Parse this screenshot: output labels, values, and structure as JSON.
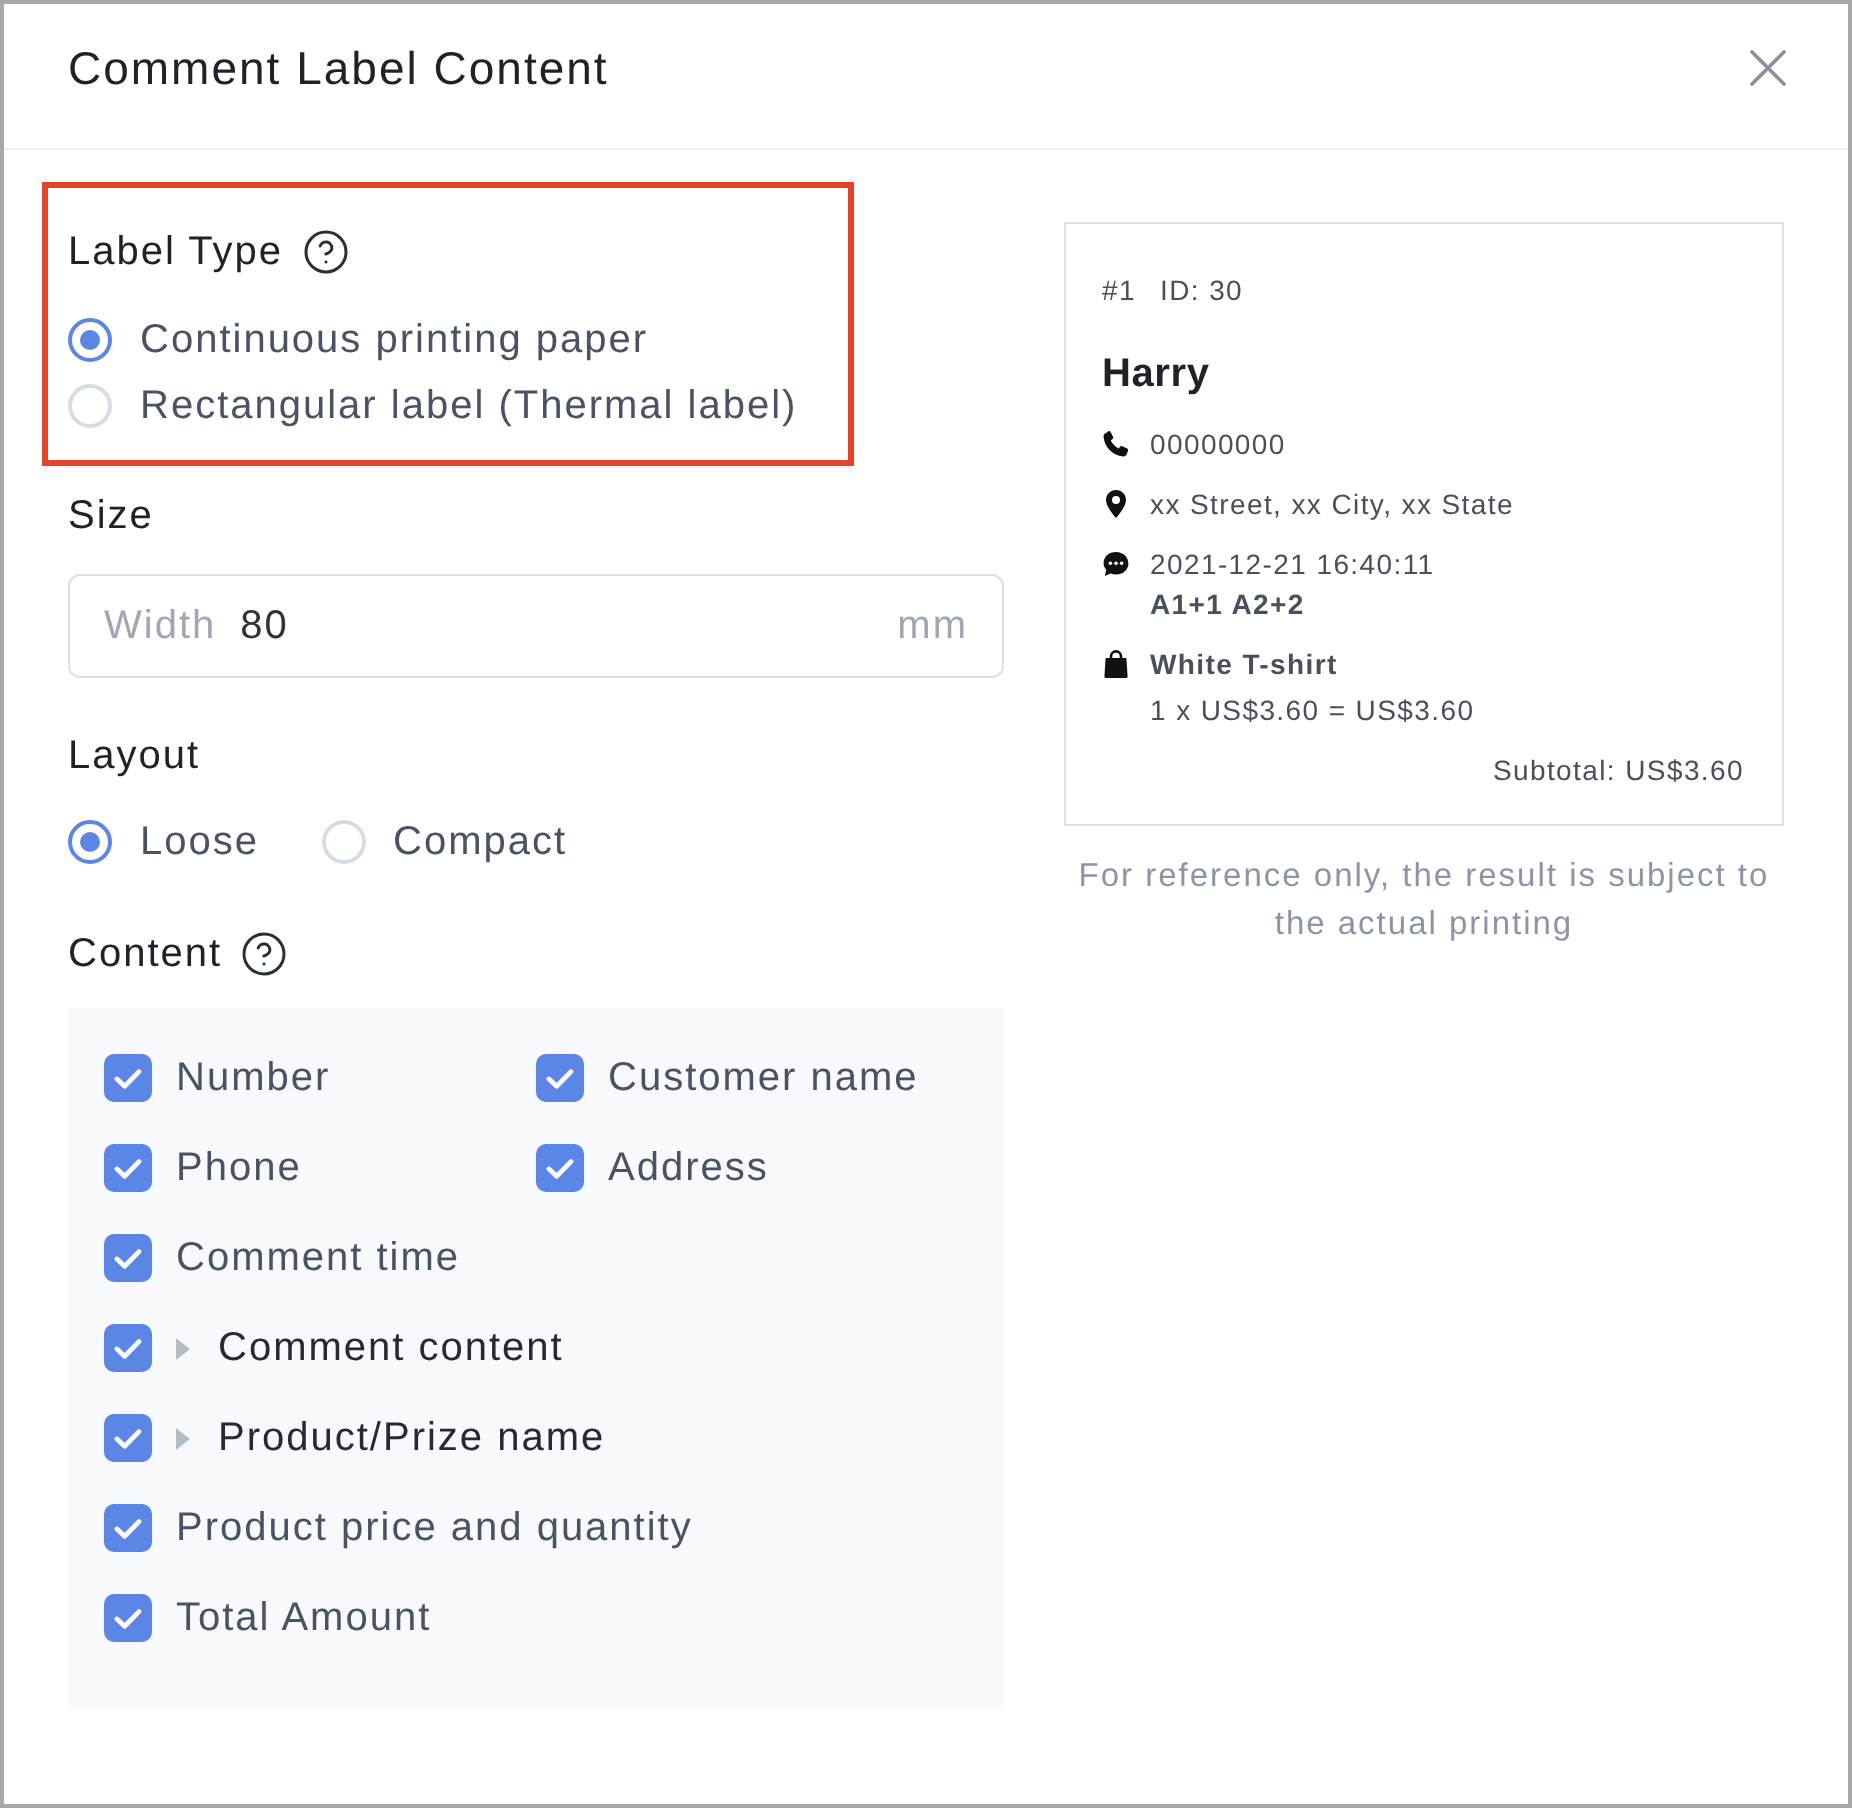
{
  "dialog": {
    "title": "Comment Label Content"
  },
  "label_type": {
    "heading": "Label Type",
    "highlighted": true,
    "options": [
      {
        "label": "Continuous printing paper",
        "selected": true
      },
      {
        "label": "Rectangular label (Thermal label)",
        "selected": false
      }
    ]
  },
  "size": {
    "heading": "Size",
    "field": {
      "label": "Width",
      "value": "80",
      "unit": "mm"
    }
  },
  "layout": {
    "heading": "Layout",
    "options": [
      {
        "label": "Loose",
        "selected": true
      },
      {
        "label": "Compact",
        "selected": false
      }
    ]
  },
  "content": {
    "heading": "Content",
    "rows": [
      {
        "items": [
          {
            "label": "Number",
            "kind": "option",
            "checked": true
          },
          {
            "label": "Customer name",
            "kind": "option",
            "checked": true
          }
        ]
      },
      {
        "items": [
          {
            "label": "Phone",
            "kind": "option",
            "checked": true
          },
          {
            "label": "Address",
            "kind": "option",
            "checked": true
          }
        ]
      },
      {
        "items": [
          {
            "label": "Comment time",
            "kind": "option",
            "checked": true
          }
        ]
      },
      {
        "items": [
          {
            "label": "Comment content",
            "kind": "group",
            "checked": true
          }
        ]
      },
      {
        "items": [
          {
            "label": "Product/Prize name",
            "kind": "group",
            "checked": true
          }
        ]
      },
      {
        "items": [
          {
            "label": "Product price and quantity",
            "kind": "option",
            "checked": true
          }
        ]
      },
      {
        "items": [
          {
            "label": "Total Amount",
            "kind": "option",
            "checked": true
          }
        ]
      }
    ]
  },
  "preview": {
    "number": "#1",
    "id": "ID: 30",
    "name": "Harry",
    "lines": [
      {
        "kind": "phone",
        "text": "00000000"
      },
      {
        "kind": "address",
        "text": "xx Street, xx City, xx State"
      },
      {
        "kind": "comment",
        "text": "2021-12-21 16:40:11",
        "detail": "A1+1 A2+2"
      },
      {
        "kind": "product",
        "text": "White T-shirt",
        "detail": "1 x US$3.60 = US$3.60"
      }
    ],
    "subtotal": "Subtotal: US$3.60"
  },
  "note": "For reference only, the result is subject to the actual printing"
}
